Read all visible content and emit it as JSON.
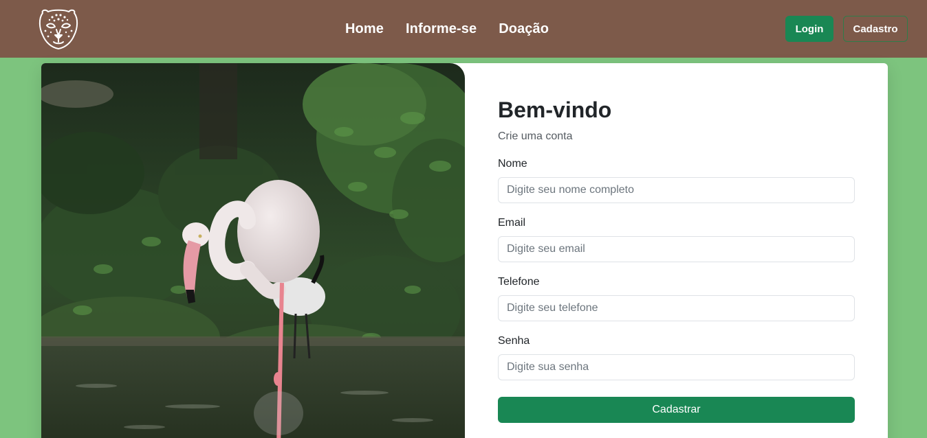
{
  "navbar": {
    "logo_icon": "jaguar-head-icon",
    "links": [
      {
        "label": "Home"
      },
      {
        "label": "Informe-se"
      },
      {
        "label": "Doação"
      }
    ],
    "login_label": "Login",
    "cadastro_label": "Cadastro"
  },
  "hero_image": {
    "subject": "flamingo-photo"
  },
  "form": {
    "title": "Bem-vindo",
    "subtitle": "Crie uma conta",
    "fields": [
      {
        "label": "Nome",
        "placeholder": "Digite seu nome completo",
        "value": ""
      },
      {
        "label": "Email",
        "placeholder": "Digite seu email",
        "value": ""
      },
      {
        "label": "Telefone",
        "placeholder": "Digite seu telefone",
        "value": ""
      },
      {
        "label": "Senha",
        "placeholder": "Digite sua senha",
        "value": ""
      }
    ],
    "submit_label": "Cadastrar"
  },
  "colors": {
    "navbar_bg": "#7d5a4a",
    "page_bg": "#7dc47e",
    "primary_green": "#198754"
  }
}
